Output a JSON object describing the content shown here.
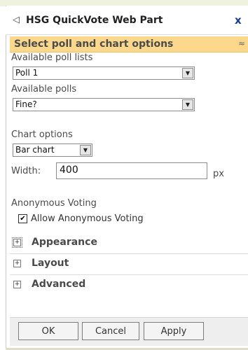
{
  "header": {
    "back_icon": "◁",
    "title": "HSG QuickVote Web Part",
    "close_icon": "x"
  },
  "section": {
    "title": "Select poll and chart options",
    "collapse_icon": "≈"
  },
  "poll_lists": {
    "label": "Available poll lists",
    "selected": "Poll 1"
  },
  "polls": {
    "label": "Available polls",
    "selected": "Fine?"
  },
  "chart": {
    "label": "Chart options",
    "selected": "Bar chart"
  },
  "width": {
    "label": "Width:",
    "value": "400",
    "unit": "px"
  },
  "anonymous": {
    "label": "Anonymous Voting",
    "checkbox_label": "Allow Anonymous Voting",
    "checked": true,
    "check_mark": "✔"
  },
  "groups": [
    {
      "label": "Appearance",
      "icon": "+"
    },
    {
      "label": "Layout",
      "icon": "+"
    },
    {
      "label": "Advanced",
      "icon": "+"
    }
  ],
  "buttons": {
    "ok": "OK",
    "cancel": "Cancel",
    "apply": "Apply"
  },
  "colors": {
    "section_header_bg": "#fbd88c",
    "close_icon": "#1a3f8f"
  }
}
